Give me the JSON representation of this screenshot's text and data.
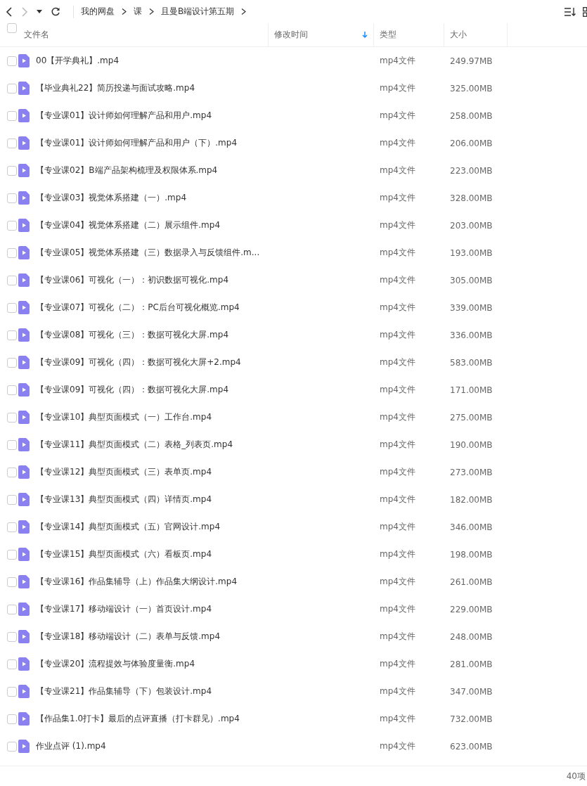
{
  "breadcrumb": [
    "我的网盘",
    "课",
    "且曼B端设计第五期"
  ],
  "columns": [
    {
      "label": "文件名",
      "sorted": false
    },
    {
      "label": "修改时间",
      "sorted": true
    },
    {
      "label": "类型",
      "sorted": false
    },
    {
      "label": "大小",
      "sorted": false
    }
  ],
  "files": [
    {
      "name": "00【开学典礼】.mp4",
      "type": "mp4文件",
      "size": "249.97MB",
      "checked": false
    },
    {
      "name": "【毕业典礼22】简历投递与面试攻略.mp4",
      "type": "mp4文件",
      "size": "325.00MB",
      "checked": false
    },
    {
      "name": "【专业课01】设计师如何理解产品和用户.mp4",
      "type": "mp4文件",
      "size": "258.00MB",
      "checked": false
    },
    {
      "name": "【专业课01】设计师如何理解产品和用户（下）.mp4",
      "type": "mp4文件",
      "size": "206.00MB",
      "checked": false
    },
    {
      "name": "【专业课02】B端产品架构梳理及权限体系.mp4",
      "type": "mp4文件",
      "size": "223.00MB",
      "checked": false
    },
    {
      "name": "【专业课03】视觉体系搭建（一）.mp4",
      "type": "mp4文件",
      "size": "328.00MB",
      "checked": false
    },
    {
      "name": "【专业课04】视觉体系搭建（二）展示组件.mp4",
      "type": "mp4文件",
      "size": "203.00MB",
      "checked": false
    },
    {
      "name": "【专业课05】视觉体系搭建（三）数据录入与反馈组件.m...",
      "type": "mp4文件",
      "size": "193.00MB",
      "checked": false
    },
    {
      "name": "【专业课06】可视化（一）：初识数据可视化.mp4",
      "type": "mp4文件",
      "size": "305.00MB",
      "checked": false
    },
    {
      "name": "【专业课07】可视化（二）：PC后台可视化概览.mp4",
      "type": "mp4文件",
      "size": "339.00MB",
      "checked": false
    },
    {
      "name": "【专业课08】可视化（三）：数据可视化大屏.mp4",
      "type": "mp4文件",
      "size": "336.00MB",
      "checked": false
    },
    {
      "name": "【专业课09】可视化（四）：数据可视化大屏+2.mp4",
      "type": "mp4文件",
      "size": "583.00MB",
      "checked": false
    },
    {
      "name": "【专业课09】可视化（四）：数据可视化大屏.mp4",
      "type": "mp4文件",
      "size": "171.00MB",
      "checked": false
    },
    {
      "name": "【专业课10】典型页面模式（一）工作台.mp4",
      "type": "mp4文件",
      "size": "275.00MB",
      "checked": false
    },
    {
      "name": "【专业课11】典型页面模式（二）表格_列表页.mp4",
      "type": "mp4文件",
      "size": "190.00MB",
      "checked": false
    },
    {
      "name": "【专业课12】典型页面模式（三）表单页.mp4",
      "type": "mp4文件",
      "size": "273.00MB",
      "checked": false
    },
    {
      "name": "【专业课13】典型页面模式（四）详情页.mp4",
      "type": "mp4文件",
      "size": "182.00MB",
      "checked": false
    },
    {
      "name": "【专业课14】典型页面模式（五）官网设计.mp4",
      "type": "mp4文件",
      "size": "346.00MB",
      "checked": false
    },
    {
      "name": "【专业课15】典型页面模式（六）看板页.mp4",
      "type": "mp4文件",
      "size": "198.00MB",
      "checked": false
    },
    {
      "name": "【专业课16】作品集辅导（上）作品集大纲设计.mp4",
      "type": "mp4文件",
      "size": "261.00MB",
      "checked": false
    },
    {
      "name": "【专业课17】移动端设计（一）首页设计.mp4",
      "type": "mp4文件",
      "size": "229.00MB",
      "checked": false
    },
    {
      "name": "【专业课18】移动端设计（二）表单与反馈.mp4",
      "type": "mp4文件",
      "size": "248.00MB",
      "checked": false
    },
    {
      "name": "【专业课20】流程提效与体验度量衡.mp4",
      "type": "mp4文件",
      "size": "281.00MB",
      "checked": false
    },
    {
      "name": "【专业课21】作品集辅导（下）包装设计.mp4",
      "type": "mp4文件",
      "size": "347.00MB",
      "checked": false
    },
    {
      "name": "【作品集1.0打卡】最后的点评直播（打卡群见）.mp4",
      "type": "mp4文件",
      "size": "732.00MB",
      "checked": false
    },
    {
      "name": "作业点评 (1).mp4",
      "type": "mp4文件",
      "size": "623.00MB",
      "checked": false
    }
  ],
  "select_all_checked": false,
  "item_count": "40项"
}
